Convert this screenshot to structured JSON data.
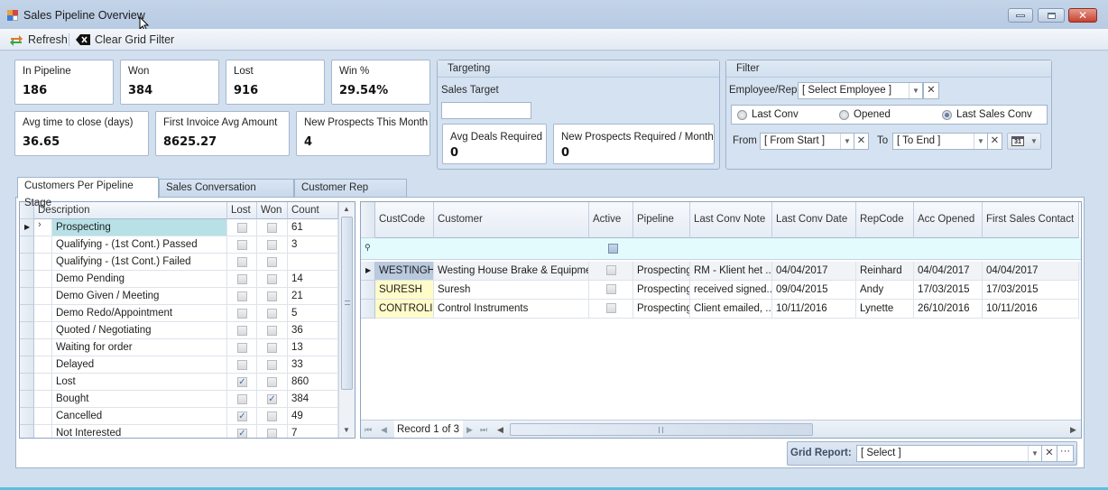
{
  "window": {
    "title": "Sales Pipeline Overview",
    "buttons": {
      "minimize": "minimize",
      "maximize": "maximize",
      "close": "close"
    }
  },
  "toolbar": {
    "refresh_label": "Refresh",
    "refresh_icon": "refresh-icon",
    "clear_filter_label": "Clear Grid Filter",
    "clear_filter_icon": "clear-filter-icon"
  },
  "stats": {
    "in_pipeline": {
      "label": "In Pipeline",
      "value": "186"
    },
    "won": {
      "label": "Won",
      "value": "384"
    },
    "lost": {
      "label": "Lost",
      "value": "916"
    },
    "win_pct": {
      "label": "Win %",
      "value": "29.54%"
    },
    "avg_time": {
      "label": "Avg time to close (days)",
      "value": "36.65"
    },
    "first_invoice": {
      "label": "First Invoice Avg Amount",
      "value": "8625.27"
    },
    "new_prospects": {
      "label": "New Prospects This Month",
      "value": "4"
    }
  },
  "targeting": {
    "title": "Targeting",
    "sales_target_label": "Sales Target",
    "sales_target_value": "",
    "avg_deals": {
      "label": "Avg Deals Required",
      "value": "0"
    },
    "new_prospects_required": {
      "label": "New Prospects Required / Month",
      "value": "0"
    }
  },
  "filter": {
    "title": "Filter",
    "employee_label": "Employee/Rep",
    "employee_value": "[ Select Employee ]",
    "radios": [
      {
        "label": "Last Conv",
        "selected": false
      },
      {
        "label": "Opened",
        "selected": false
      },
      {
        "label": "Last Sales Conv",
        "selected": true
      }
    ],
    "from_label": "From",
    "from_value": "[ From Start ]",
    "to_label": "To",
    "to_value": "[ To End ]",
    "calendar_icon": "31"
  },
  "tabs": [
    {
      "label": "Customers Per Pipeline Stage",
      "active": true
    },
    {
      "label": "Sales Conversation Analysis",
      "active": false
    },
    {
      "label": "Customer Rep Analysis",
      "active": false
    }
  ],
  "stage_grid": {
    "columns": [
      "Description",
      "Lost",
      "Won",
      "Count"
    ],
    "rows": [
      {
        "description": "Prospecting",
        "lost": false,
        "won": false,
        "count": "61",
        "selected": true
      },
      {
        "description": "Qualifying - (1st Cont.) Passed",
        "lost": false,
        "won": false,
        "count": "3"
      },
      {
        "description": "Qualifying - (1st Cont.) Failed",
        "lost": false,
        "won": false,
        "count": ""
      },
      {
        "description": "Demo Pending",
        "lost": false,
        "won": false,
        "count": "14"
      },
      {
        "description": "Demo Given / Meeting",
        "lost": false,
        "won": false,
        "count": "21"
      },
      {
        "description": "Demo Redo/Appointment",
        "lost": false,
        "won": false,
        "count": "5"
      },
      {
        "description": "Quoted / Negotiating",
        "lost": false,
        "won": false,
        "count": "36"
      },
      {
        "description": "Waiting for order",
        "lost": false,
        "won": false,
        "count": "13"
      },
      {
        "description": "Delayed",
        "lost": false,
        "won": false,
        "count": "33"
      },
      {
        "description": "Lost",
        "lost": true,
        "won": false,
        "count": "860"
      },
      {
        "description": "Bought",
        "lost": false,
        "won": true,
        "count": "384"
      },
      {
        "description": "Cancelled",
        "lost": true,
        "won": false,
        "count": "49"
      },
      {
        "description": "Not Interested",
        "lost": true,
        "won": false,
        "count": "7"
      }
    ]
  },
  "customer_grid": {
    "columns": [
      "CustCode",
      "Customer",
      "Active",
      "Pipeline",
      "Last Conv Note",
      "Last Conv Date",
      "RepCode",
      "Acc Opened",
      "First Sales Contact"
    ],
    "rows": [
      {
        "custcode": "WESTINGH",
        "customer": "Westing House Brake & Equipment",
        "active": false,
        "pipeline": "Prospecting",
        "note": "RM - Klient het ...",
        "last_conv_date": "04/04/2017",
        "repcode": "Reinhard",
        "acc_opened": "04/04/2017",
        "first_contact": "04/04/2017"
      },
      {
        "custcode": "SURESH",
        "customer": "Suresh",
        "active": false,
        "pipeline": "Prospecting",
        "note": "received signed...",
        "last_conv_date": "09/04/2015",
        "repcode": "Andy",
        "acc_opened": "17/03/2015",
        "first_contact": "17/03/2015"
      },
      {
        "custcode": "CONTROLI",
        "customer": "Control Instruments",
        "active": false,
        "pipeline": "Prospecting",
        "note": "Client emailed, ...",
        "last_conv_date": "10/11/2016",
        "repcode": "Lynette",
        "acc_opened": "26/10/2016",
        "first_contact": "10/11/2016"
      }
    ],
    "record_text": "Record 1 of 3"
  },
  "grid_report": {
    "label": "Grid Report:",
    "value": "[ Select ]"
  },
  "colors": {
    "selected_row": "#b7e1e6",
    "filter_row": "#e3fbfd",
    "custcode_highlight": "#fffcc9",
    "custcode_selected": "#b9c9de"
  }
}
